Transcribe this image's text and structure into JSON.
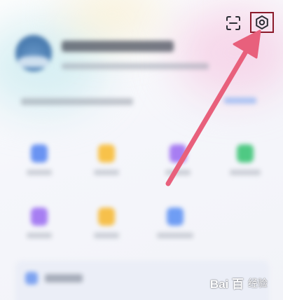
{
  "header": {
    "scan_icon": "scan-icon",
    "settings_icon": "gear-icon"
  },
  "annotation": {
    "arrow_color": "#e8607c",
    "highlight_color": "#8b1a2a"
  },
  "grid": {
    "tile_colors": [
      "#6a93f2",
      "#f8c24a",
      "#a77df2",
      "#4fc983",
      "#a67ef2",
      "#f6c04b",
      "#6f9df4"
    ]
  },
  "watermark": {
    "logo": "Bai  百",
    "sub": "经验"
  }
}
